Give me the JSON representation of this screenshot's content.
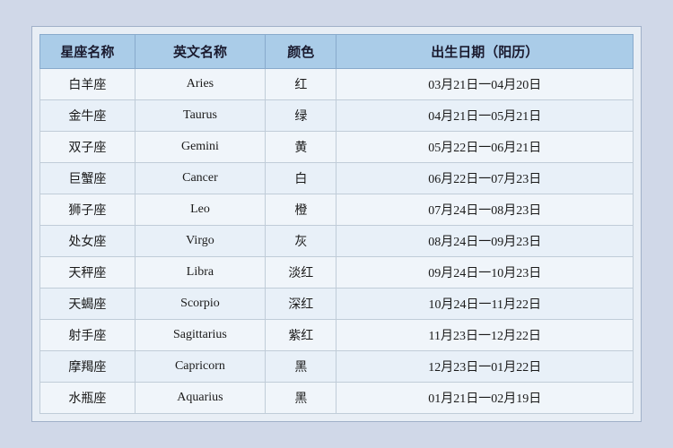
{
  "table": {
    "headers": {
      "zh_name": "星座名称",
      "en_name": "英文名称",
      "color": "颜色",
      "date": "出生日期（阳历）"
    },
    "rows": [
      {
        "zh": "白羊座",
        "en": "Aries",
        "color": "红",
        "date": "03月21日一04月20日"
      },
      {
        "zh": "金牛座",
        "en": "Taurus",
        "color": "绿",
        "date": "04月21日一05月21日"
      },
      {
        "zh": "双子座",
        "en": "Gemini",
        "color": "黄",
        "date": "05月22日一06月21日"
      },
      {
        "zh": "巨蟹座",
        "en": "Cancer",
        "color": "白",
        "date": "06月22日一07月23日"
      },
      {
        "zh": "狮子座",
        "en": "Leo",
        "color": "橙",
        "date": "07月24日一08月23日"
      },
      {
        "zh": "处女座",
        "en": "Virgo",
        "color": "灰",
        "date": "08月24日一09月23日"
      },
      {
        "zh": "天秤座",
        "en": "Libra",
        "color": "淡红",
        "date": "09月24日一10月23日"
      },
      {
        "zh": "天蝎座",
        "en": "Scorpio",
        "color": "深红",
        "date": "10月24日一11月22日"
      },
      {
        "zh": "射手座",
        "en": "Sagittarius",
        "color": "紫红",
        "date": "11月23日一12月22日"
      },
      {
        "zh": "摩羯座",
        "en": "Capricorn",
        "color": "黑",
        "date": "12月23日一01月22日"
      },
      {
        "zh": "水瓶座",
        "en": "Aquarius",
        "color": "黑",
        "date": "01月21日一02月19日"
      }
    ]
  }
}
